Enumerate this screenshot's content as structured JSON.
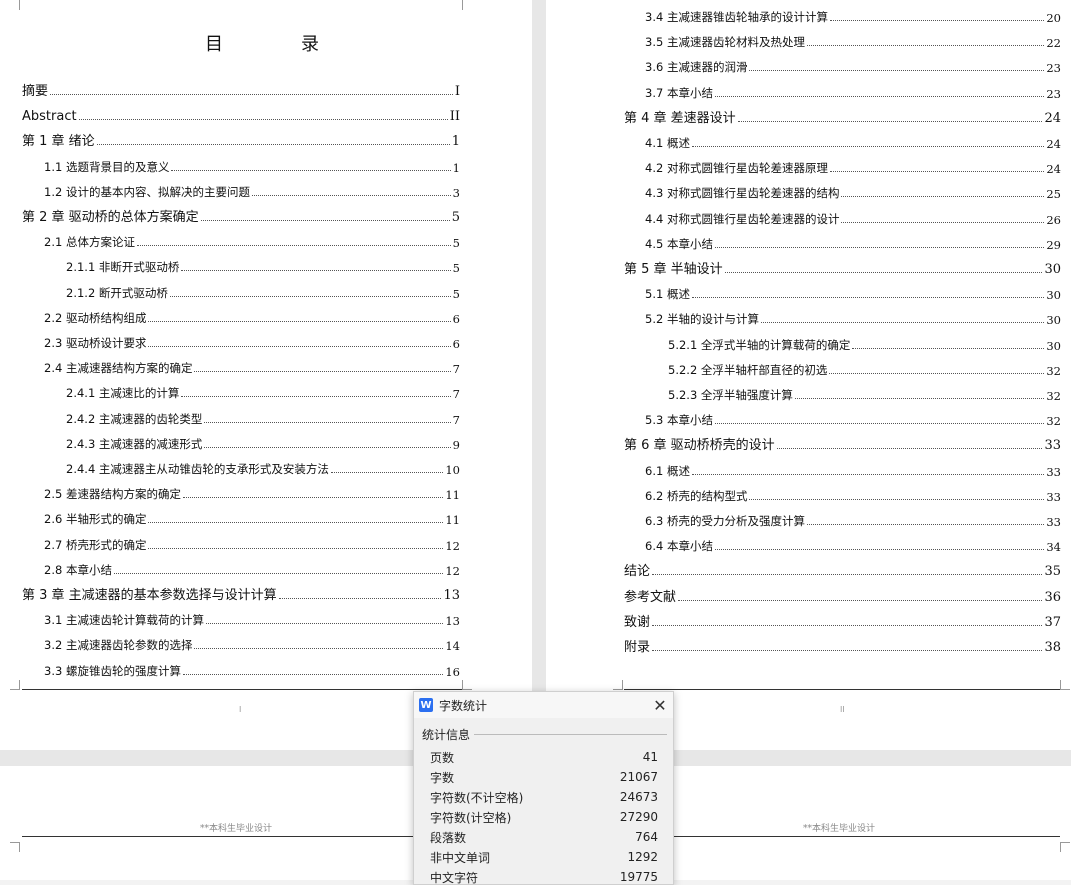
{
  "left_page": {
    "title": "目　录",
    "entries": [
      {
        "text": "摘要",
        "page": "I",
        "level": 0
      },
      {
        "text": "Abstract",
        "page": "II",
        "level": 0
      },
      {
        "text": "第 1 章  绪论",
        "page": "1",
        "level": 0
      },
      {
        "text": "1.1 选题背景目的及意义",
        "page": "1",
        "level": 1
      },
      {
        "text": "1.2 设计的基本内容、拟解决的主要问题",
        "page": "3",
        "level": 1
      },
      {
        "text": "第 2 章  驱动桥的总体方案确定",
        "page": "5",
        "level": 0
      },
      {
        "text": "2.1 总体方案论证",
        "page": "5",
        "level": 1
      },
      {
        "text": "2.1.1  非断开式驱动桥",
        "page": "5",
        "level": 2
      },
      {
        "text": "2.1.2  断开式驱动桥",
        "page": "5",
        "level": 2
      },
      {
        "text": "2.2 驱动桥结构组成",
        "page": "6",
        "level": 1
      },
      {
        "text": "2.3 驱动桥设计要求",
        "page": "6",
        "level": 1
      },
      {
        "text": "2.4 主减速器结构方案的确定",
        "page": "7",
        "level": 1
      },
      {
        "text": "2.4.1 主减速比的计算",
        "page": "7",
        "level": 2
      },
      {
        "text": "2.4.2 主减速器的齿轮类型",
        "page": "7",
        "level": 2
      },
      {
        "text": "2.4.3 主减速器的减速形式",
        "page": "9",
        "level": 2
      },
      {
        "text": "2.4.4 主减速器主从动锥齿轮的支承形式及安装方法",
        "page": "10",
        "level": 2
      },
      {
        "text": "2.5 差速器结构方案的确定",
        "page": "11",
        "level": 1
      },
      {
        "text": "2.6 半轴形式的确定",
        "page": "11",
        "level": 1
      },
      {
        "text": "2.7 桥壳形式的确定",
        "page": "12",
        "level": 1
      },
      {
        "text": "2.8 本章小结",
        "page": "12",
        "level": 1
      },
      {
        "text": "第 3 章  主减速器的基本参数选择与设计计算",
        "page": "13",
        "level": 0
      },
      {
        "text": "3.1 主减速齿轮计算载荷的计算",
        "page": "13",
        "level": 1
      },
      {
        "text": "3.2 主减速器齿轮参数的选择",
        "page": "14",
        "level": 1
      },
      {
        "text": "3.3 螺旋锥齿轮的强度计算",
        "page": "16",
        "level": 1
      }
    ],
    "page_number": "I",
    "footer": "**本科生毕业设计"
  },
  "right_page": {
    "entries": [
      {
        "text": "3.4 主减速器锥齿轮轴承的设计计算",
        "page": "20",
        "level": 1
      },
      {
        "text": "3.5 主减速器齿轮材料及热处理",
        "page": "22",
        "level": 1
      },
      {
        "text": "3.6 主减速器的润滑",
        "page": "23",
        "level": 1
      },
      {
        "text": "3.7 本章小结",
        "page": "23",
        "level": 1
      },
      {
        "text": "第 4 章  差速器设计",
        "page": "24",
        "level": 0
      },
      {
        "text": "4.1 概述",
        "page": "24",
        "level": 1
      },
      {
        "text": "4.2 对称式圆锥行星齿轮差速器原理",
        "page": "24",
        "level": 1
      },
      {
        "text": "4.3 对称式圆锥行星齿轮差速器的结构",
        "page": "25",
        "level": 1
      },
      {
        "text": "4.4 对称式圆锥行星齿轮差速器的设计",
        "page": "26",
        "level": 1
      },
      {
        "text": "4.5 本章小结",
        "page": "29",
        "level": 1
      },
      {
        "text": "第 5 章  半轴设计",
        "page": "30",
        "level": 0
      },
      {
        "text": "5.1 概述",
        "page": "30",
        "level": 1
      },
      {
        "text": "5.2 半轴的设计与计算",
        "page": "30",
        "level": 1
      },
      {
        "text": "5.2.1 全浮式半轴的计算载荷的确定",
        "page": "30",
        "level": 2
      },
      {
        "text": "5.2.2 全浮半轴杆部直径的初选",
        "page": "32",
        "level": 2
      },
      {
        "text": "5.2.3 全浮半轴强度计算",
        "page": "32",
        "level": 2
      },
      {
        "text": "5.3 本章小结",
        "page": "32",
        "level": 1
      },
      {
        "text": "第 6 章  驱动桥桥壳的设计",
        "page": "33",
        "level": 0
      },
      {
        "text": "6.1 概述",
        "page": "33",
        "level": 1
      },
      {
        "text": "6.2 桥壳的结构型式",
        "page": "33",
        "level": 1
      },
      {
        "text": "6.3 桥壳的受力分析及强度计算",
        "page": "33",
        "level": 1
      },
      {
        "text": "6.4 本章小结",
        "page": "34",
        "level": 1
      },
      {
        "text": "结论",
        "page": "35",
        "level": 0
      },
      {
        "text": "参考文献",
        "page": "36",
        "level": 0
      },
      {
        "text": "致谢",
        "page": "37",
        "level": 0
      },
      {
        "text": "附录",
        "page": "38",
        "level": 0
      }
    ],
    "page_number": "II",
    "footer": "**本科生毕业设计"
  },
  "dialog": {
    "title": "字数统计",
    "logo": "W",
    "close_icon": "close-icon",
    "section": "统计信息",
    "stats": [
      {
        "label": "页数",
        "value": "41"
      },
      {
        "label": "字数",
        "value": "21067"
      },
      {
        "label": "字符数(不计空格)",
        "value": "24673"
      },
      {
        "label": "字符数(计空格)",
        "value": "27290"
      },
      {
        "label": "段落数",
        "value": "764"
      },
      {
        "label": "非中文单词",
        "value": "1292"
      },
      {
        "label": "中文字符",
        "value": "19775"
      }
    ]
  }
}
